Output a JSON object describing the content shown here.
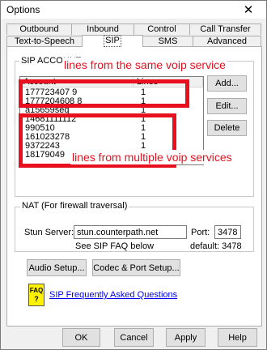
{
  "window": {
    "title": "Options",
    "close_glyph": "✕"
  },
  "tabs_row1": [
    {
      "label": "Outbound"
    },
    {
      "label": "Inbound"
    },
    {
      "label": "Control"
    },
    {
      "label": "Call Transfer"
    }
  ],
  "tabs_row2": [
    {
      "label": "Text-to-Speech"
    },
    {
      "label": "SIP",
      "active": true
    },
    {
      "label": "SMS"
    },
    {
      "label": "Advanced"
    }
  ],
  "sip_account": {
    "group_label": "SIP ACCOUNT",
    "columns": [
      "Account",
      "Lines"
    ],
    "rows": [
      {
        "account": "177723407 9",
        "lines": "1"
      },
      {
        "account": "1777204608 8",
        "lines": "1"
      },
      {
        "account": "a15659seq",
        "lines": "1"
      },
      {
        "account": "14681111112",
        "lines": "1"
      },
      {
        "account": "990510",
        "lines": "1"
      },
      {
        "account": "161023278",
        "lines": "1"
      },
      {
        "account": "9372243",
        "lines": "1"
      },
      {
        "account": "18179049",
        "lines": "1"
      }
    ],
    "buttons": {
      "add": "Add...",
      "edit": "Edit...",
      "delete": "Delete"
    }
  },
  "annotations": {
    "same_service": "lines from the same voip service",
    "multiple_services": "lines from multiple voip services"
  },
  "nat": {
    "group_label": "NAT (For firewall traversal)",
    "stun_label": "Stun Server:",
    "stun_value": "stun.counterpath.net",
    "port_label": "Port:",
    "port_value": "3478",
    "faq_note": "See SIP FAQ below",
    "default_text": "default: 3478"
  },
  "setup_buttons": {
    "audio": "Audio Setup...",
    "codec": "Codec & Port Setup..."
  },
  "faq": {
    "icon_text": "FAQ",
    "icon_sub": "?",
    "link": "SIP Frequently Asked Questions"
  },
  "footer": {
    "ok": "OK",
    "cancel": "Cancel",
    "apply": "Apply",
    "help": "Help"
  },
  "colors": {
    "annotation": "#e8101e",
    "link": "#0000ee",
    "faq_icon": "#fff200"
  }
}
